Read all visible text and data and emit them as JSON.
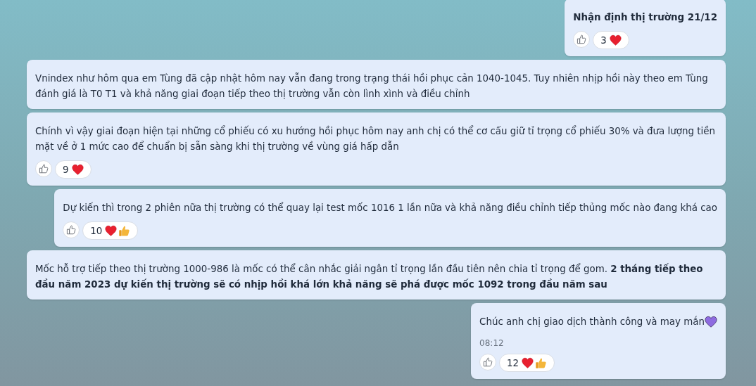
{
  "messages": [
    {
      "text": "Nhận định thị trường 21/12",
      "bold": true,
      "reactions": {
        "count": "3",
        "emojis": [
          {
            "kind": "heart"
          }
        ]
      }
    },
    {
      "text": "Vnindex như hôm qua em Tùng đã cập nhật hôm nay vẫn đang trong trạng thái hồi phục cản 1040-1045. Tuy nhiên nhịp hồi này theo em Tùng đánh giá là T0 T1 và khả năng giai đoạn tiếp theo thị trường vẫn còn lình xình và điều chỉnh",
      "bold": false
    },
    {
      "text": "Chính vì vậy giai đoạn hiện tại những cổ phiếu có xu hướng hồi phục hôm nay anh chị có thể cơ cấu giữ tỉ trọng cổ phiếu 30% và đưa lượng tiền mặt về ở 1 mức cao để chuẩn bị sẵn sàng khi thị trường về vùng giá hấp dẫn",
      "bold": false,
      "reactions": {
        "count": "9",
        "emojis": [
          {
            "kind": "heart"
          }
        ]
      }
    },
    {
      "text": "Dự kiến thì trong 2 phiên nữa thị trường có thể quay lại test mốc 1016 1 lần nữa và khả năng điều chỉnh tiếp thủng mốc nào đang khá cao",
      "bold": false,
      "reactions": {
        "count": "10",
        "emojis": [
          {
            "kind": "heart"
          },
          {
            "kind": "thumbsup"
          }
        ]
      }
    },
    {
      "text": "Mốc hỗ trợ tiếp theo thị trường 1000-986 là mốc có thể cân nhắc giải ngân tỉ trọng lần đầu tiên nên chia tỉ trọng để gom. **2 tháng tiếp theo đầu năm 2023 dự kiến thị trường sẽ có nhịp hồi khá lớn khả năng sẽ phá được mốc 1092 trong đầu năm sau**",
      "bold": false
    },
    {
      "text": "Chúc anh chị giao dịch thành công và may mắn",
      "bold": false,
      "end_emoji": {
        "kind": "heart",
        "color": "#8e6be0"
      },
      "time": "08:12",
      "reactions": {
        "count": "12",
        "emojis": [
          {
            "kind": "heart"
          },
          {
            "kind": "thumbsup"
          }
        ]
      }
    }
  ]
}
